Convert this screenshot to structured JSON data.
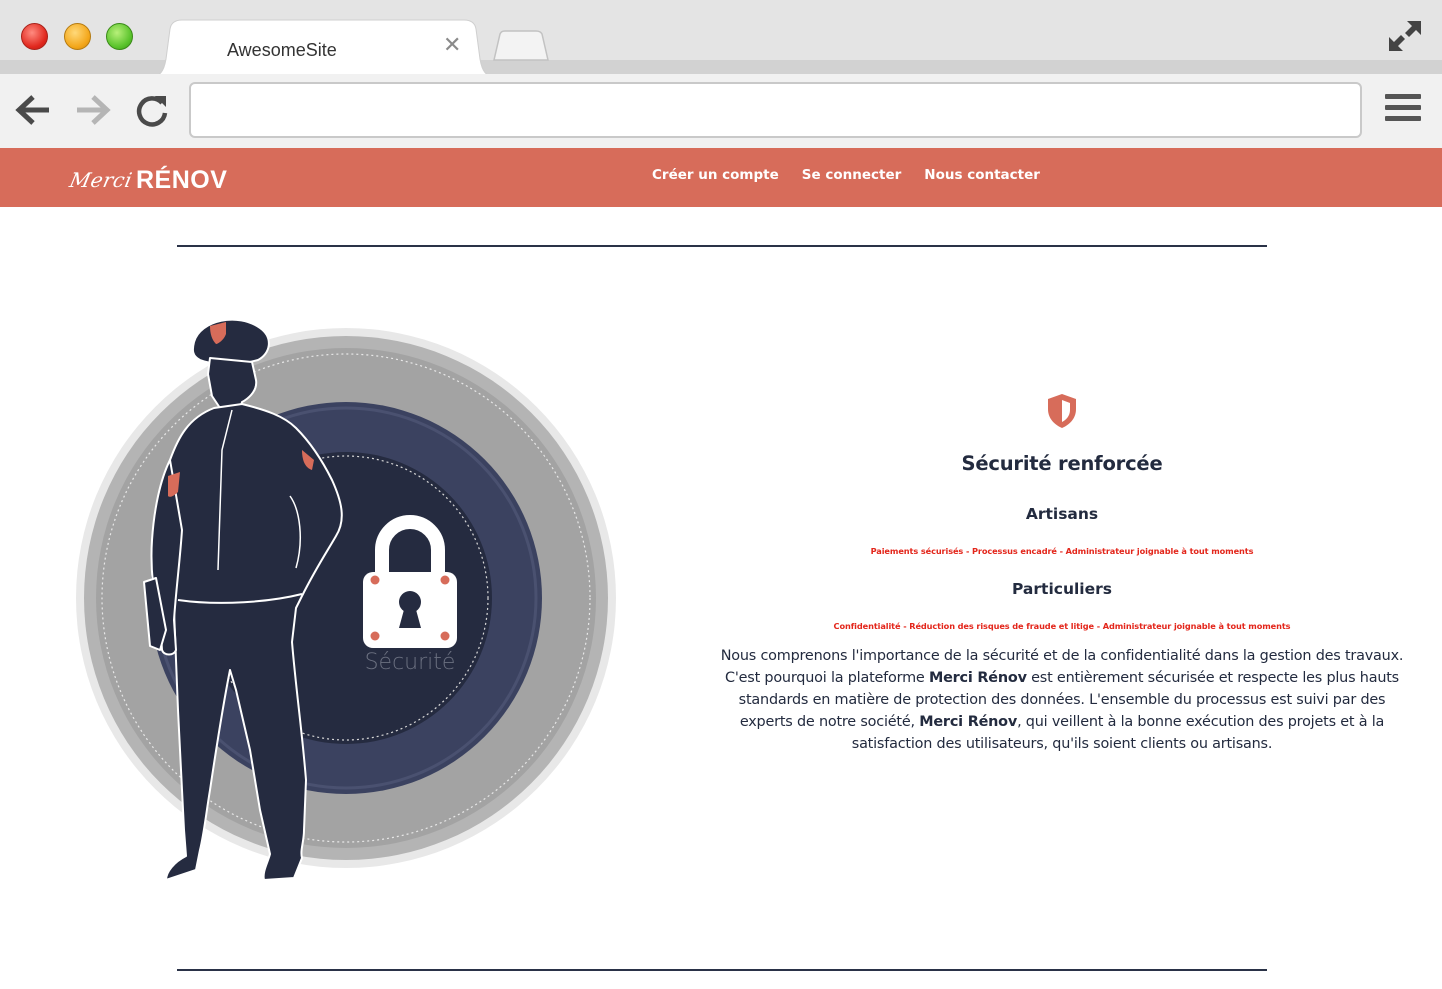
{
  "browser": {
    "tab_title": "AwesomeSite",
    "tab_close": "✕",
    "url_value": "",
    "colors": {
      "close": "#e0271d",
      "minimize": "#f3a619",
      "maximize": "#58c22a"
    }
  },
  "header": {
    "logo_script": "Merci",
    "logo_bold": "RÉNOV",
    "nav": [
      "Créer un compte",
      "Se connecter",
      "Nous contacter"
    ],
    "background": "#d76c5a"
  },
  "illustration": {
    "lock_label": "Sécurité"
  },
  "feature": {
    "icon": "shield-icon",
    "title": "Sécurité renforcée",
    "sections": [
      {
        "title": "Artisans",
        "tagline": "Paiements sécurisés - Processus encadré - Administrateur joignable à tout moments"
      },
      {
        "title": "Particuliers",
        "tagline": "Confidentialité - Réduction des risques de fraude et litige - Administrateur joignable à tout moments"
      }
    ],
    "description": {
      "p1": "Nous comprenons l'importance de la sécurité et de la confidentialité dans la gestion des travaux. C'est pourquoi la plateforme ",
      "brand1": "Merci Rénov",
      "p2": " est entièrement sécurisée et respecte les plus hauts standards en matière de protection des données. L'ensemble du processus est suivi par des experts de notre société, ",
      "brand2": "Merci Rénov",
      "p3": ", qui veillent à la bonne exécution des projets et à la satisfaction des utilisateurs, qu'ils soient clients ou artisans."
    },
    "accent": "#e3261b"
  }
}
